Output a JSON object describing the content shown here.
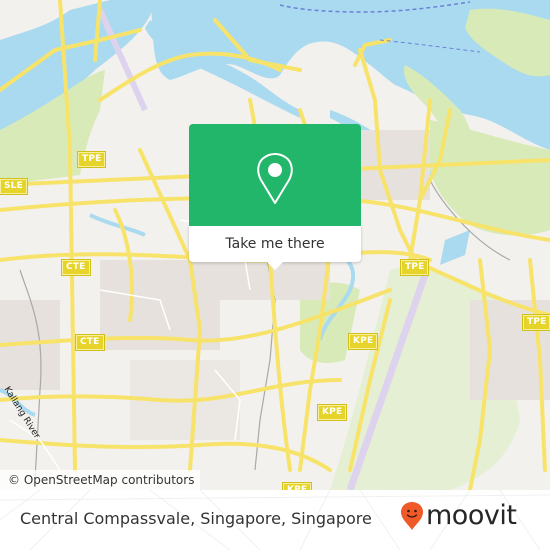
{
  "map": {
    "attribution": "© OpenStreetMap contributors",
    "river_label": "Kallang River",
    "road_shields": [
      {
        "label": "TPE",
        "id": "tpe-1"
      },
      {
        "label": "SLE",
        "id": "sle-1"
      },
      {
        "label": "CTE",
        "id": "cte-1"
      },
      {
        "label": "CTE",
        "id": "cte-2"
      },
      {
        "label": "TPE",
        "id": "tpe-2"
      },
      {
        "label": "TPE",
        "id": "tpe-3"
      },
      {
        "label": "KPE",
        "id": "kpe-1"
      },
      {
        "label": "KPE",
        "id": "kpe-2"
      },
      {
        "label": "KPE",
        "id": "kpe-3"
      }
    ],
    "colors": {
      "water": "#aadaef",
      "land": "#f2f1ee",
      "park": "#d8eab8",
      "road": "#f8e36a",
      "residential": "#e6e1dc",
      "runway": "#ddd3ee"
    }
  },
  "popup": {
    "icon": "location-pin-icon",
    "button_label": "Take me there",
    "color": "#22b66a"
  },
  "footer": {
    "place_name": "Central Compassvale, Singapore, Singapore",
    "brand": "moovit",
    "brand_icon": "moovit-smiley-pin-icon",
    "brand_color": "#f05a28"
  }
}
